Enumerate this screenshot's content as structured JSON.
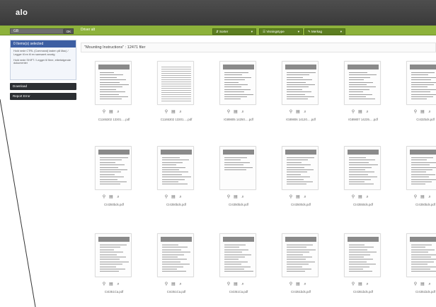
{
  "header": {
    "logo": "alo"
  },
  "toolbar": {
    "search_value": "GB",
    "search_button": "OK",
    "breadcrumb": "Driver alt",
    "dropdowns": [
      {
        "label": "Sorter"
      },
      {
        "label": "Visningstype"
      },
      {
        "label": "Merkag"
      }
    ]
  },
  "sidebar": {
    "panel_title": "0 Items(s) selected",
    "panel_text_1": "Hold nede CTRL (Command) tasten på Mac) / Legger til en til en samsamt avvalg",
    "panel_text_2": "Hold nede SHIFT / Legger til flere, etterfølgende dokumenter",
    "btn_download": "Download",
    "btn_report": "Report Error"
  },
  "main": {
    "title": "\"Mounting Instructions\" : 12471 filer"
  },
  "documents": [
    {
      "name": "C1165302 13301.....pdf",
      "style": "normal"
    },
    {
      "name": "C1165302 13301.....pdf",
      "style": "dense"
    },
    {
      "name": "IG89805 14250.....pdf",
      "style": "normal"
    },
    {
      "name": "IG89806 14120.....pdf",
      "style": "normal"
    },
    {
      "name": "IG89807 14235.....pdf",
      "style": "normal"
    },
    {
      "name": "CI432bds.pdf",
      "style": "normal"
    },
    {
      "name": "CI4350bds.pdf",
      "style": "normal"
    },
    {
      "name": "CI4350bds.pdf",
      "style": "normal"
    },
    {
      "name": "CI4350bds.pdf",
      "style": "sparse"
    },
    {
      "name": "CI43500ds.pdf",
      "style": "normal"
    },
    {
      "name": "CI43550ds.pdf",
      "style": "normal"
    },
    {
      "name": "CI4350bds.pdf",
      "style": "normal"
    },
    {
      "name": "CI4351Ca.pdf",
      "style": "normal"
    },
    {
      "name": "CI4351Ca.pdf",
      "style": "normal"
    },
    {
      "name": "CI4351Ca.pdf",
      "style": "normal"
    },
    {
      "name": "CI4351bds.pdf",
      "style": "normal"
    },
    {
      "name": "CI4351bds.pdf",
      "style": "normal"
    },
    {
      "name": "CI4351bds.pdf",
      "style": "normal"
    }
  ],
  "card_icons": [
    "pin-icon",
    "save-icon",
    "zoom-icon"
  ],
  "colors": {
    "header": "#3f3f3f",
    "toolbar_green": "#8db23b",
    "panel_blue": "#3d5fa3",
    "button_dark": "#2c2f33"
  }
}
